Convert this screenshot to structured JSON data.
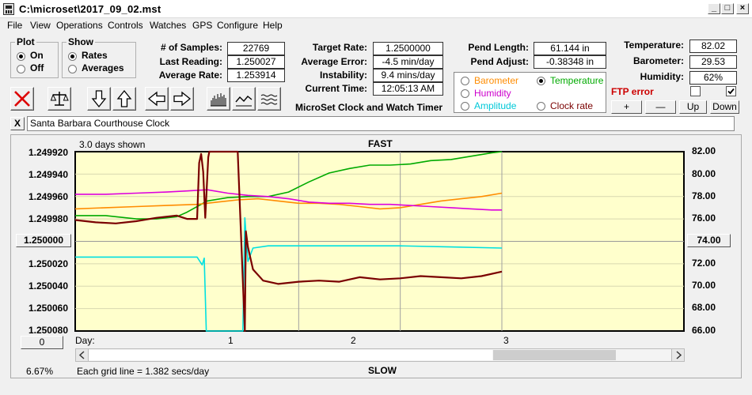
{
  "window": {
    "title": "C:\\microset\\2017_09_02.mst"
  },
  "menu": [
    "File",
    "View",
    "Operations",
    "Controls",
    "Watches",
    "GPS",
    "Configure",
    "Help"
  ],
  "plot": {
    "title": "Plot",
    "on": "On",
    "off": "Off"
  },
  "show": {
    "title": "Show",
    "rates": "Rates",
    "averages": "Averages"
  },
  "stats": {
    "samples_label": "# of Samples:",
    "samples": "22769",
    "last_label": "Last Reading:",
    "last": "1.250027",
    "avgrate_label": "Average Rate:",
    "avgrate": "1.253914",
    "target_label": "Target Rate:",
    "target": "1.2500000",
    "avgerr_label": "Average Error:",
    "avgerr": "-4.5 min/day",
    "instab_label": "Instability:",
    "instab": "9.4 mins/day",
    "time_label": "Current Time:",
    "time": "12:05:13 AM",
    "pendlen_label": "Pend Length:",
    "pendlen": "61.144 in",
    "pendadj_label": "Pend Adjust:",
    "pendadj": "-0.38348 in",
    "temp_label": "Temperature:",
    "temp": "82.02",
    "baro_label": "Barometer:",
    "baro": "29.53",
    "hum_label": "Humidity:",
    "hum": "62%"
  },
  "app_name": "MicroSet Clock and Watch Timer",
  "selector": {
    "barometer": "Barometer",
    "temperature": "Temperature",
    "humidity": "Humidity",
    "amplitude": "Amplitude",
    "clockrate": "Clock rate"
  },
  "ftp_error": "FTP error",
  "buttons": {
    "plus": "+",
    "minus": "—",
    "up": "Up",
    "down": "Down"
  },
  "clock_name": "Santa Barbara Courthouse Clock",
  "close_x": "X",
  "colors": {
    "barometer": "#ff8c00",
    "temperature": "#00aa00",
    "humidity": "#dd00dd",
    "amplitude": "#00e0e0",
    "rate": "#7a0000",
    "ftp": "#cc0000",
    "plot_bg": "#ffffcc"
  },
  "chart_data": {
    "type": "line",
    "top_label": "FAST",
    "bottom_label": "SLOW",
    "days_shown": "3.0 days shown",
    "grid_note": "Each grid line = 1.382 secs/day",
    "x_label": "Day:",
    "x_ticks": [
      "1",
      "2",
      "3"
    ],
    "xlim": [
      -1.2,
      3.0
    ],
    "left_ticks": [
      "1.249920",
      "1.249940",
      "1.249960",
      "1.249980",
      "1.250000",
      "1.250020",
      "1.250040",
      "1.250060",
      "1.250080"
    ],
    "left_center": "1.250000",
    "right_ticks": [
      "82.00",
      "80.00",
      "78.00",
      "76.00",
      "74.00",
      "72.00",
      "70.00",
      "68.00",
      "66.00"
    ],
    "right_center": "74.00",
    "left_range": [
      1.24992,
      1.25008
    ],
    "right_range": [
      66,
      82
    ],
    "series": [
      {
        "name": "Temperature",
        "color": "#00aa00",
        "x": [
          -1.2,
          -0.9,
          -0.6,
          -0.4,
          -0.2,
          -0.1,
          0.1,
          0.3,
          0.5,
          0.7,
          0.9,
          1.1,
          1.3,
          1.5,
          1.7,
          1.9,
          2.1,
          2.3,
          2.5,
          2.7,
          2.9,
          3.0
        ],
        "y": [
          76.3,
          76.3,
          76.0,
          76.0,
          76.2,
          76.6,
          77.6,
          77.9,
          78.0,
          78.0,
          78.4,
          79.3,
          80.1,
          80.5,
          80.8,
          80.8,
          80.9,
          81.2,
          81.3,
          81.6,
          81.9,
          82.0
        ]
      },
      {
        "name": "Barometer",
        "color": "#ff8c00",
        "x": [
          -1.2,
          -0.9,
          -0.6,
          -0.3,
          0.0,
          0.2,
          0.4,
          0.6,
          0.8,
          1.0,
          1.2,
          1.4,
          1.6,
          1.8,
          2.0,
          2.2,
          2.4,
          2.6,
          2.8,
          3.0
        ],
        "y": [
          76.9,
          77.0,
          77.1,
          77.2,
          77.3,
          77.5,
          77.7,
          77.8,
          77.6,
          77.4,
          77.4,
          77.3,
          77.1,
          76.9,
          77.0,
          77.3,
          77.6,
          77.8,
          78.0,
          78.3
        ]
      },
      {
        "name": "Humidity",
        "color": "#dd00dd",
        "x": [
          -1.2,
          -0.9,
          -0.6,
          -0.3,
          -0.1,
          0.1,
          0.3,
          0.5,
          0.7,
          0.9,
          1.1,
          1.3,
          1.5,
          1.7,
          1.9,
          2.1,
          2.3,
          2.5,
          2.7,
          2.9,
          3.0
        ],
        "y": [
          78.2,
          78.2,
          78.3,
          78.4,
          78.5,
          78.6,
          78.3,
          78.1,
          78.0,
          77.8,
          77.5,
          77.4,
          77.4,
          77.3,
          77.3,
          77.2,
          77.1,
          77.0,
          76.9,
          76.8,
          76.8
        ]
      },
      {
        "name": "Amplitude",
        "color": "#00e0e0",
        "x": [
          -1.2,
          -0.6,
          0.0,
          0.05,
          0.07,
          0.09,
          0.1,
          0.11,
          0.2,
          0.35,
          0.45,
          0.47,
          0.5,
          0.55,
          0.7,
          1.0,
          1.5,
          2.0,
          2.5,
          3.0
        ],
        "y": [
          72.6,
          72.6,
          72.6,
          71.9,
          72.5,
          66.0,
          66.0,
          66.0,
          66.0,
          66.0,
          66.0,
          76.1,
          72.2,
          73.4,
          73.6,
          73.6,
          73.6,
          73.6,
          73.5,
          73.4
        ]
      },
      {
        "name": "Clock rate",
        "color": "#7a0000",
        "x": [
          -1.2,
          -1.0,
          -0.8,
          -0.6,
          -0.4,
          -0.2,
          -0.1,
          0.0,
          0.02,
          0.04,
          0.06,
          0.08,
          0.11,
          0.12,
          0.15,
          0.2,
          0.3,
          0.4,
          0.47,
          0.48,
          0.5,
          0.55,
          0.65,
          0.8,
          1.0,
          1.2,
          1.4,
          1.6,
          1.8,
          2.0,
          2.2,
          2.4,
          2.6,
          2.8,
          3.0
        ],
        "y": [
          75.9,
          75.7,
          75.6,
          75.8,
          76.1,
          76.3,
          76.0,
          76.0,
          81.0,
          81.8,
          80.2,
          76.1,
          81.5,
          82.0,
          82.0,
          82.0,
          82.0,
          82.0,
          66.0,
          74.9,
          73.5,
          71.5,
          70.5,
          70.2,
          70.4,
          70.5,
          70.4,
          70.8,
          70.6,
          70.7,
          70.9,
          70.8,
          70.7,
          70.9,
          71.3
        ]
      }
    ]
  },
  "scroll_value": "0",
  "percent": "6.67%"
}
